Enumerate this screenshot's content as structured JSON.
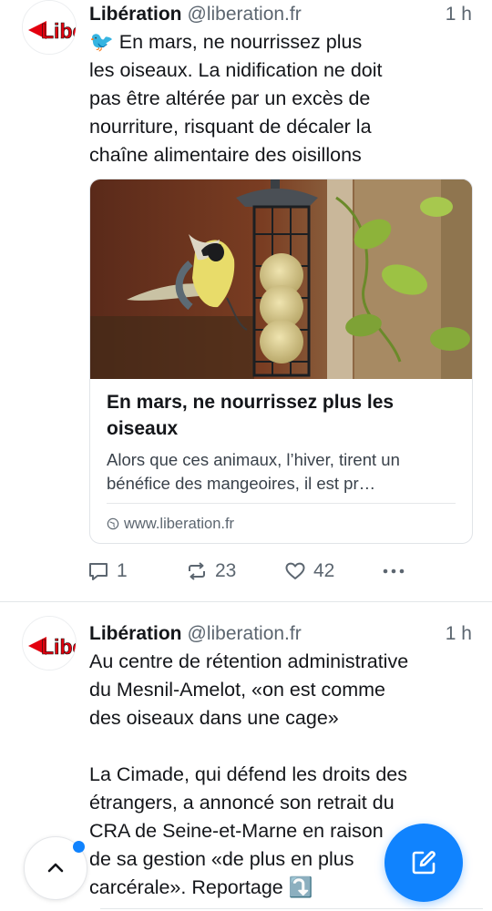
{
  "posts": [
    {
      "author": "Libération",
      "handle": "@liberation.fr",
      "time": "1 h",
      "emoji": "🐦",
      "text": " En mars, ne nourrissez plus\nles oiseaux. La nidification ne doit\npas être altérée par un excès de\nnourriture, risquant de décaler la\nchaîne alimentaire des oisillons",
      "card": {
        "title": "En mars, ne nourrissez plus les oiseaux",
        "description": "Alors que ces animaux, l’hiver, tirent un bénéfice des mangeoires, il est pr…",
        "domain": "www.liberation.fr",
        "image_alt": "bird-at-feeder-photo"
      },
      "replies": "1",
      "reposts": "23",
      "likes": "42"
    },
    {
      "author": "Libération",
      "handle": "@liberation.fr",
      "time": "1 h",
      "text": "Au centre de rétention administrative\ndu Mesnil-Amelot, «on est comme\ndes oiseaux dans une cage»\n\nLa Cimade, qui défend les droits des\nétrangers, a annoncé son retrait du\nCRA de Seine-et-Marne en raison\nde sa gestion «de plus en plus\ncarcérale». Reportage ⤵️"
    }
  ],
  "icons": {
    "avatar": "libe-logo",
    "reply": "speech-bubble-icon",
    "repost": "repost-arrows-icon",
    "like": "heart-icon",
    "more": "ellipsis-icon",
    "globe": "globe-icon",
    "scroll_top": "chevron-up-icon",
    "compose": "pencil-square-icon"
  },
  "colors": {
    "accent": "#1083fe",
    "text": "#14161a",
    "muted": "#5c6670",
    "logo_red": "#e3000f"
  }
}
